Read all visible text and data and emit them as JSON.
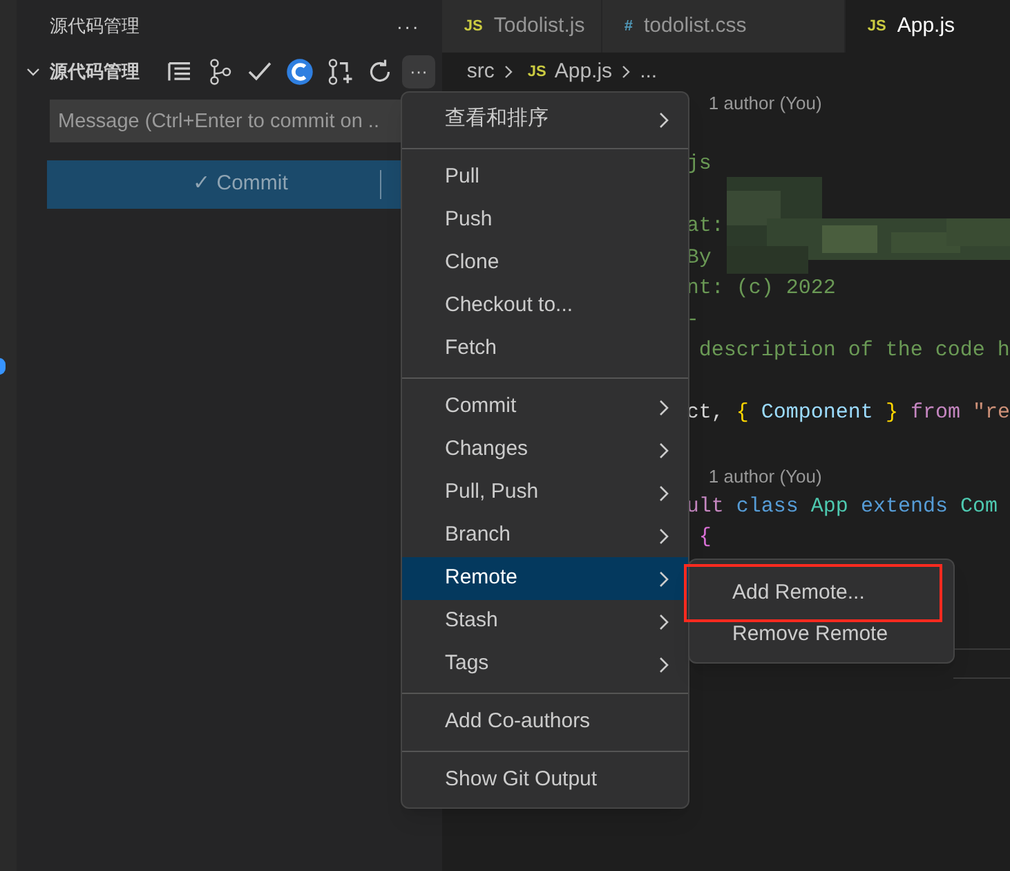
{
  "sidebar": {
    "title": "源代码管理",
    "more": "···",
    "section": {
      "title": "源代码管理",
      "expanded": true,
      "more": "···",
      "toolbar": [
        {
          "kind": "list"
        },
        {
          "kind": "graph"
        },
        {
          "kind": "check"
        },
        {
          "kind": "extension"
        },
        {
          "kind": "pull-request"
        },
        {
          "kind": "refresh"
        }
      ]
    },
    "message": {
      "placeholder": "Message (Ctrl+Enter to commit on .."
    },
    "commit_button": {
      "label": "✓ Commit"
    }
  },
  "tabs": [
    {
      "label": "Todolist.js",
      "icon": "JS",
      "kind": "js",
      "selected": false
    },
    {
      "label": "todolist.css",
      "icon": "#",
      "kind": "css",
      "selected": false
    },
    {
      "label": "App.js",
      "icon": "JS",
      "kind": "js",
      "selected": true
    }
  ],
  "breadcrumb": [
    {
      "label": "src"
    },
    {
      "label": "App.js",
      "icon": "JS"
    },
    {
      "label": "..."
    }
  ],
  "editor": {
    "lines": [
      {
        "kind": "lens",
        "text": "1 author (You)"
      },
      {
        "kind": "blank"
      },
      {
        "kind": "code",
        "tokens": [
          {
            "t": "js",
            "kind": "comment"
          }
        ]
      },
      {
        "kind": "blank"
      },
      {
        "kind": "code",
        "tokens": [
          {
            "t": "at:",
            "kind": "comment"
          }
        ]
      },
      {
        "kind": "code",
        "tokens": [
          {
            "t": "By",
            "kind": "comment"
          }
        ]
      },
      {
        "kind": "code",
        "tokens": [
          {
            "t": "nt: (c) 2022",
            "kind": "comment"
          }
        ]
      },
      {
        "kind": "code",
        "tokens": [
          {
            "t": "-",
            "kind": "comment"
          }
        ]
      },
      {
        "kind": "code",
        "tokens": [
          {
            "t": " description of the code h",
            "kind": "comment"
          }
        ]
      },
      {
        "kind": "blank"
      },
      {
        "kind": "code",
        "tokens": [
          {
            "t": "ct, ",
            "kind": "plain"
          },
          {
            "t": "{",
            "kind": "brace"
          },
          {
            "t": " Component ",
            "kind": "var"
          },
          {
            "t": "}",
            "kind": "brace"
          },
          {
            "t": " from ",
            "kind": "keyword"
          },
          {
            "t": "\"re",
            "kind": "string"
          }
        ]
      },
      {
        "kind": "blank"
      },
      {
        "kind": "lens",
        "text": "1 author (You)"
      },
      {
        "kind": "code",
        "tokens": [
          {
            "t": "ult ",
            "kind": "keyword"
          },
          {
            "t": "class ",
            "kind": "storage"
          },
          {
            "t": "App ",
            "kind": "type"
          },
          {
            "t": "extends ",
            "kind": "storage"
          },
          {
            "t": "Com",
            "kind": "type"
          }
        ]
      },
      {
        "kind": "code",
        "tokens": [
          {
            "t": " {",
            "kind": "brace2"
          }
        ]
      }
    ]
  },
  "menu": [
    [
      {
        "label": "查看和排序",
        "submenu": true,
        "selected": false
      }
    ],
    [
      {
        "label": "Pull",
        "submenu": false,
        "selected": false
      },
      {
        "label": "Push",
        "submenu": false,
        "selected": false
      },
      {
        "label": "Clone",
        "submenu": false,
        "selected": false
      },
      {
        "label": "Checkout to...",
        "submenu": false,
        "selected": false
      },
      {
        "label": "Fetch",
        "submenu": false,
        "selected": false
      }
    ],
    [
      {
        "label": "Commit",
        "submenu": true,
        "selected": false
      },
      {
        "label": "Changes",
        "submenu": true,
        "selected": false
      },
      {
        "label": "Pull, Push",
        "submenu": true,
        "selected": false
      },
      {
        "label": "Branch",
        "submenu": true,
        "selected": false
      },
      {
        "label": "Remote",
        "submenu": true,
        "selected": true
      },
      {
        "label": "Stash",
        "submenu": true,
        "selected": false
      },
      {
        "label": "Tags",
        "submenu": true,
        "selected": false
      }
    ],
    [
      {
        "label": "Add Co-authors",
        "submenu": false,
        "selected": false
      }
    ],
    [
      {
        "label": "Show Git Output",
        "submenu": false,
        "selected": false
      }
    ]
  ],
  "submenu": [
    {
      "label": "Add Remote...",
      "outlined": true
    },
    {
      "label": "Remove Remote",
      "outlined": false
    }
  ]
}
